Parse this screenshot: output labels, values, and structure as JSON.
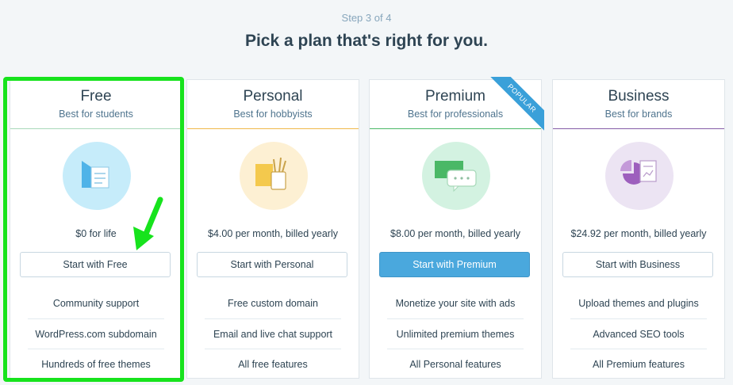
{
  "header": {
    "step": "Step 3 of 4",
    "title": "Pick a plan that's right for you."
  },
  "plans": [
    {
      "name": "Free",
      "tagline": "Best for students",
      "price": "$0 for life",
      "cta": "Start with Free",
      "accent": "#a8d8b9",
      "icon": "plan-free-icon",
      "features": [
        "Community support",
        "WordPress.com subdomain",
        "Hundreds of free themes"
      ]
    },
    {
      "name": "Personal",
      "tagline": "Best for hobbyists",
      "price": "$4.00 per month, billed yearly",
      "cta": "Start with Personal",
      "accent": "#f0b849",
      "icon": "plan-personal-icon",
      "features": [
        "Free custom domain",
        "Email and live chat support",
        "All free features"
      ]
    },
    {
      "name": "Premium",
      "tagline": "Best for professionals",
      "price": "$8.00 per month, billed yearly",
      "cta": "Start with Premium",
      "accent": "#4ab866",
      "icon": "plan-premium-icon",
      "badge": "POPULAR",
      "features": [
        "Monetize your site with ads",
        "Unlimited premium themes",
        "All Personal features"
      ]
    },
    {
      "name": "Business",
      "tagline": "Best for brands",
      "price": "$24.92 per month, billed yearly",
      "cta": "Start with Business",
      "accent": "#855da6",
      "icon": "plan-business-icon",
      "features": [
        "Upload themes and plugins",
        "Advanced SEO tools",
        "All Premium features"
      ]
    }
  ],
  "colors": {
    "highlight": "#17e31d",
    "primary_button": "#4aa8dd",
    "ribbon": "#3aa0d9"
  }
}
